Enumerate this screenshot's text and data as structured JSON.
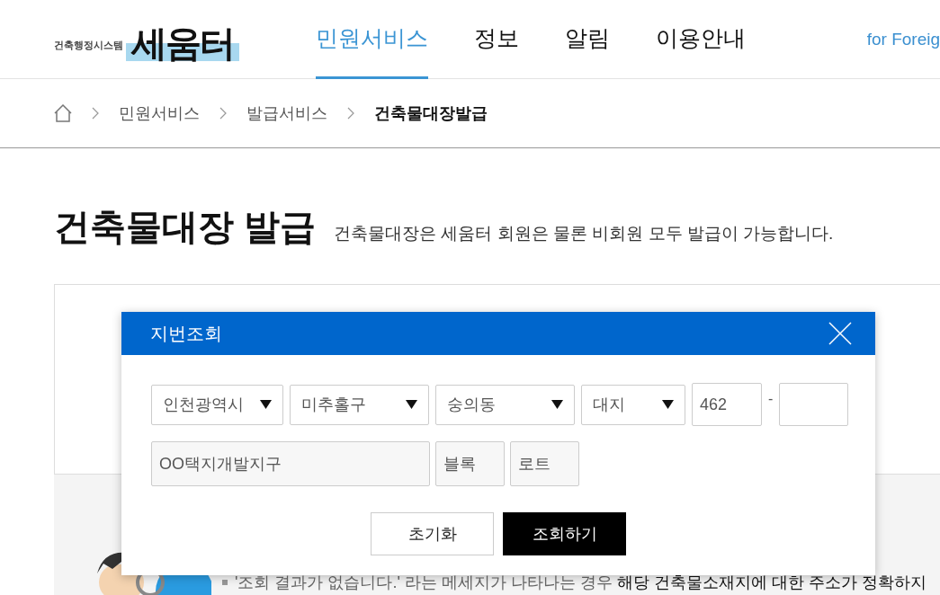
{
  "logo": {
    "name": "세움터",
    "subtitle": "건축행정시스템"
  },
  "nav": [
    {
      "label": "민원서비스",
      "selected": true
    },
    {
      "label": "정보",
      "selected": false
    },
    {
      "label": "알림",
      "selected": false
    },
    {
      "label": "이용안내",
      "selected": false
    }
  ],
  "language_link": "for Foreig",
  "breadcrumb": [
    "민원서비스",
    "발급서비스",
    "건축물대장발급"
  ],
  "page": {
    "title": "건축물대장 발급",
    "description": "건축물대장은 세움터 회원은 물론 비회원 모두 발급이 가능합니다."
  },
  "notice": {
    "text": "'조회 결과가 없습니다.' 라는 메세지가 나타나는 경우",
    "emphasis": "해당 건축물소재지에 대한 주소가 정확하지"
  },
  "dialog": {
    "title": "지번조회",
    "selects": [
      {
        "value": "인천광역시"
      },
      {
        "value": "미추홀구"
      },
      {
        "value": "숭의동"
      },
      {
        "value": "대지"
      }
    ],
    "main_number": "462",
    "separator": "-",
    "district_placeholder": "OO택지개발지구",
    "block_placeholder": "블록",
    "lot_placeholder": "로트",
    "buttons": [
      {
        "label": "초기화",
        "kind": "secondary"
      },
      {
        "label": "조회하기",
        "kind": "primary"
      }
    ]
  }
}
